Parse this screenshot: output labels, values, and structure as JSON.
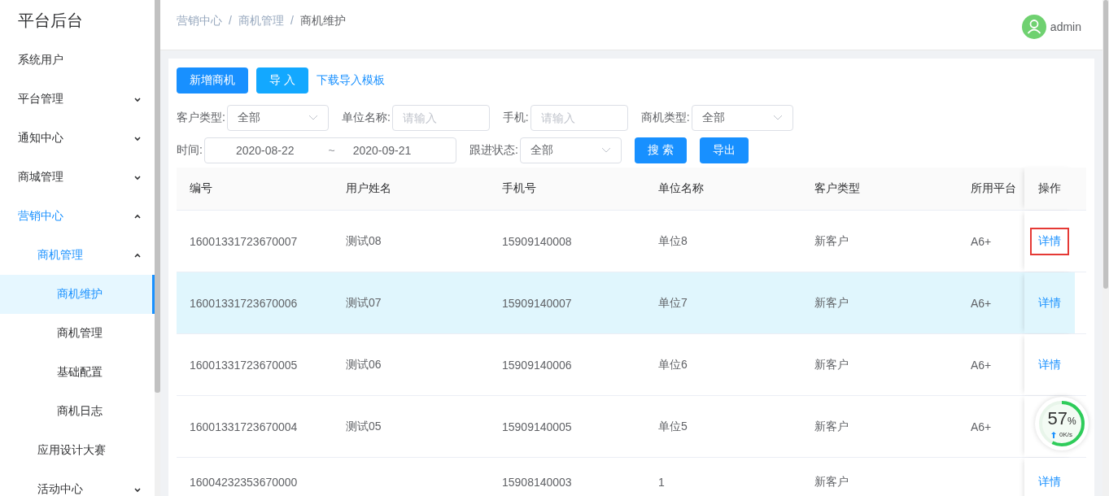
{
  "sidebar": {
    "title": "平台后台",
    "items": [
      {
        "label": "系统用户",
        "selected": false
      },
      {
        "label": "平台管理",
        "selected": false,
        "expanded": false
      },
      {
        "label": "通知中心",
        "selected": false,
        "expanded": false
      },
      {
        "label": "商城管理",
        "selected": false,
        "expanded": false
      },
      {
        "label": "营销中心",
        "selected": false,
        "expanded": true,
        "children": [
          {
            "label": "商机管理",
            "selected": false,
            "expanded": true,
            "children": [
              {
                "label": "商机维护",
                "selected": true
              },
              {
                "label": "商机管理",
                "selected": false
              },
              {
                "label": "基础配置",
                "selected": false
              },
              {
                "label": "商机日志",
                "selected": false
              }
            ]
          },
          {
            "label": "应用设计大赛",
            "selected": false
          },
          {
            "label": "活动中心",
            "selected": false,
            "expanded": false
          }
        ]
      }
    ]
  },
  "breadcrumb": {
    "items": [
      "营销中心",
      "商机管理",
      "商机维护"
    ],
    "separator": "/"
  },
  "user": {
    "name": "admin"
  },
  "actions": [
    {
      "label": "新增商机",
      "kind": "primary"
    },
    {
      "label": "导 入",
      "kind": "secondary"
    },
    {
      "label": "下载导入模板",
      "kind": "link"
    }
  ],
  "filters": [
    {
      "label": "客户类型:",
      "kind": "select",
      "value": "全部"
    },
    {
      "label": "单位名称:",
      "kind": "input",
      "placeholder": "请输入"
    },
    {
      "label": "手机:",
      "kind": "input",
      "placeholder": "请输入"
    },
    {
      "label": "商机类型:",
      "kind": "select",
      "value": "全部"
    },
    {
      "label": "时间:",
      "kind": "daterange",
      "start": "2020-08-22",
      "separator": "~",
      "end": "2020-09-21"
    },
    {
      "label": "跟进状态:",
      "kind": "select",
      "value": "全部"
    }
  ],
  "filter_buttons": [
    "搜 索",
    "导出"
  ],
  "table": {
    "columns": [
      "编号",
      "用户姓名",
      "手机号",
      "单位名称",
      "客户类型",
      "所用平台",
      "操作"
    ],
    "rows": [
      {
        "cells": [
          "16001331723670007",
          "测试08",
          "15909140008",
          "单位8",
          "新客户",
          "A6+"
        ],
        "action": "详情",
        "selected": false,
        "highlighted": true
      },
      {
        "cells": [
          "16001331723670006",
          "测试07",
          "15909140007",
          "单位7",
          "新客户",
          "A6+"
        ],
        "action": "详情",
        "selected": true
      },
      {
        "cells": [
          "16001331723670005",
          "测试06",
          "15909140006",
          "单位6",
          "新客户",
          "A6+"
        ],
        "action": "详情",
        "selected": false
      },
      {
        "cells": [
          "16001331723670004",
          "测试05",
          "15909140005",
          "单位5",
          "新客户",
          "A6+"
        ],
        "selected": false
      },
      {
        "cells": [
          "16004232353670000",
          "",
          "15908140003",
          "1",
          "新客户",
          ""
        ],
        "action": "详情",
        "selected": false
      }
    ]
  },
  "meter": {
    "value": "57",
    "unit": "%",
    "speed": "0K/s",
    "level": 0.57
  }
}
